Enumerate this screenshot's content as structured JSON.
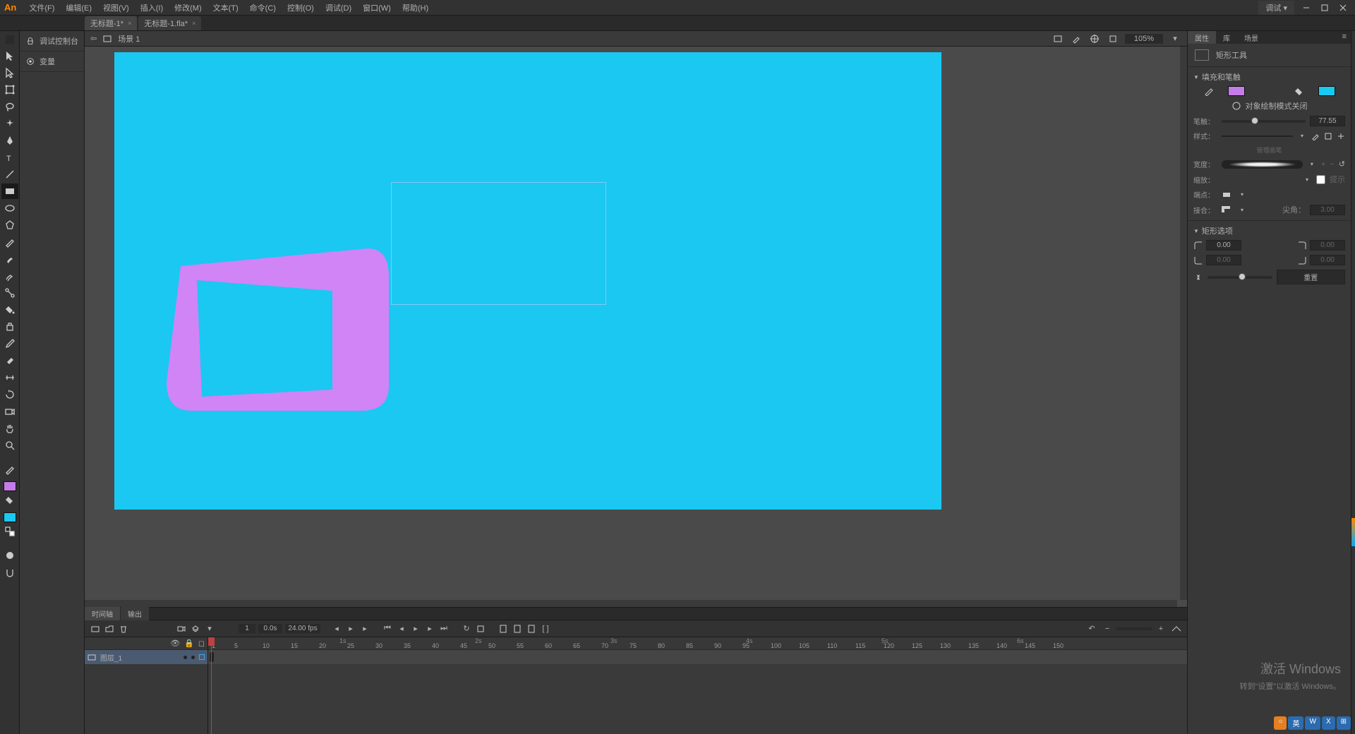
{
  "app_logo": "An",
  "menu": [
    "文件(F)",
    "编辑(E)",
    "视图(V)",
    "插入(I)",
    "修改(M)",
    "文本(T)",
    "命令(C)",
    "控制(O)",
    "调试(D)",
    "窗口(W)",
    "帮助(H)"
  ],
  "debug_dropdown": "调试 ▾",
  "doc_tabs": [
    {
      "label": "无标题-1*",
      "active": true
    },
    {
      "label": "无标题-1.fla*",
      "active": false
    }
  ],
  "left_panel": {
    "debug_console": "调试控制台",
    "variables": "变量"
  },
  "scene": {
    "label": "场景 1",
    "zoom": "105%"
  },
  "colors": {
    "stroke_swatch": "#c57ce8",
    "fill_swatch": "#1ac8f2",
    "stage": "#1ac8f2",
    "shape": "#d084f5"
  },
  "timeline": {
    "tabs": [
      "时间轴",
      "输出"
    ],
    "frame": "1",
    "time": "0.0s",
    "fps": "24.00 fps",
    "layer_name": "图层_1",
    "seconds": [
      "1s",
      "2s",
      "3s",
      "4s",
      "5s",
      "6s"
    ],
    "ticks": [
      "1",
      "5",
      "10",
      "15",
      "20",
      "25",
      "30",
      "35",
      "40",
      "45",
      "50",
      "55",
      "60",
      "65",
      "70",
      "75",
      "80",
      "85",
      "90",
      "95",
      "100",
      "105",
      "110",
      "115",
      "120",
      "125",
      "130",
      "135",
      "140",
      "145",
      "150"
    ]
  },
  "props": {
    "tabs": [
      "属性",
      "库",
      "场景"
    ],
    "tool_name": "矩形工具",
    "section_fill": "填充和笔触",
    "object_draw": "对象绘制模式关闭",
    "stroke_label": "笔触：",
    "stroke_val": "77.55",
    "style_label": "样式：",
    "manage_brush": "管理画笔",
    "width_label": "宽度：",
    "scale_label": "缩放：",
    "hint_label": "提示",
    "cap_label": "端点：",
    "join_label": "接合：",
    "miter_label": "尖角：",
    "miter_val": "3.00",
    "section_rect": "矩形选项",
    "corner_val": "0.00",
    "corner_dis": "0.00",
    "reset": "重置"
  },
  "watermark": {
    "line1": "激活 Windows",
    "line2": "转到\"设置\"以激活 Windows。"
  },
  "badges": [
    "英",
    "W",
    "X"
  ]
}
